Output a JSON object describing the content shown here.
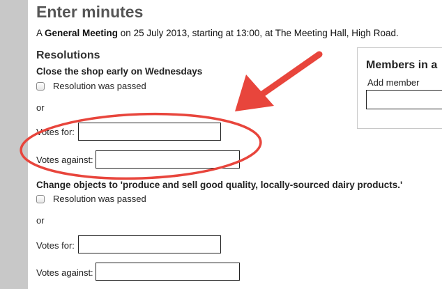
{
  "page": {
    "title": "Enter minutes",
    "meeting": {
      "prefix": "A ",
      "type": "General Meeting",
      "middle": " on 25 July 2013, starting at 13:00, at The Meeting Hall, High Road."
    }
  },
  "resolutions": {
    "heading": "Resolutions",
    "items": [
      {
        "title": "Close the shop early on Wednesdays",
        "passed_label": "Resolution was passed",
        "or_label": "or",
        "votes_for_label": "Votes for:",
        "votes_against_label": "Votes against:"
      },
      {
        "title": "Change objects to 'produce and sell good quality, locally-sourced dairy products.'",
        "passed_label": "Resolution was passed",
        "or_label": "or",
        "votes_for_label": "Votes for:",
        "votes_against_label": "Votes against:"
      }
    ]
  },
  "members": {
    "heading": "Members in a",
    "add_member_label": "Add member"
  },
  "annotation": {
    "color": "#e8453c"
  }
}
